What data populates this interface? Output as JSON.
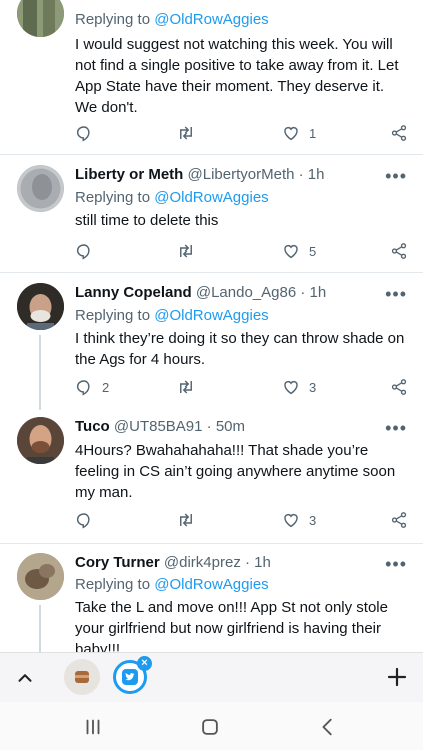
{
  "tweets": [
    {
      "name": "",
      "handle": "",
      "time": "",
      "reply_prefix": "Replying to ",
      "reply_mention": "@OldRowAggies",
      "text": "I would suggest not watching this week.  You will not find a single positive to take away from it.  Let App State have their moment.   They deserve it. We don't.",
      "reply_count": "",
      "retweet_count": "",
      "like_count": "1"
    },
    {
      "name": "Liberty or Meth",
      "handle": "@LibertyorMeth · 1h",
      "reply_prefix": "Replying to ",
      "reply_mention": "@OldRowAggies",
      "text": "still time to delete this",
      "reply_count": "",
      "retweet_count": "",
      "like_count": "5"
    },
    {
      "name": "Lanny Copeland",
      "handle": "@Lando_Ag86 · 1h",
      "reply_prefix": "Replying to ",
      "reply_mention": "@OldRowAggies",
      "text": "I think they’re doing it so they can throw shade on the Ags for 4 hours.",
      "reply_count": "2",
      "retweet_count": "",
      "like_count": "3"
    },
    {
      "name": "Tuco",
      "handle": "@UT85BA91 · 50m",
      "text": "4Hours?  Bwahahahaha!!!  That shade you’re feeling in CS ain’t going anywhere anytime soon my man.",
      "reply_count": "",
      "retweet_count": "",
      "like_count": "3"
    },
    {
      "name": "Cory Turner",
      "handle": "@dirk4prez · 1h",
      "reply_prefix": "Replying to ",
      "reply_mention": "@OldRowAggies",
      "text": "Take the L and move on!!! App St not only stole your girlfriend but now girlfriend is having their baby!!!"
    }
  ],
  "more_label": "•••",
  "tabstrip": {
    "close_label": "×"
  },
  "colors": {
    "accent": "#1d9bf0",
    "muted": "#536471",
    "text": "#0f1419",
    "divider": "#e3e8ec"
  }
}
